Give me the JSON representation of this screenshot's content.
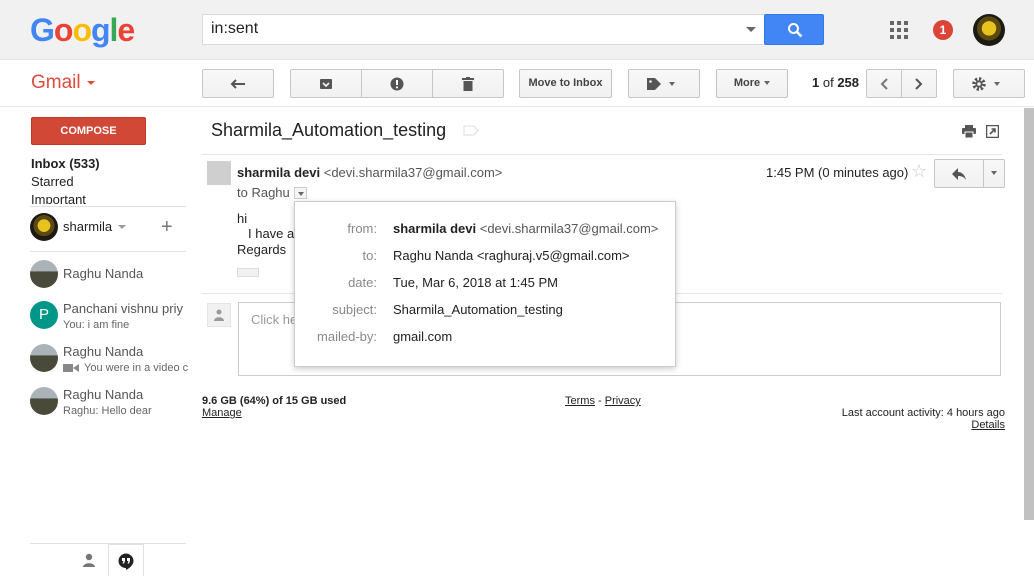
{
  "header": {
    "logo_letters": [
      {
        "ch": "G",
        "color": "#4285f4"
      },
      {
        "ch": "o",
        "color": "#ea4335"
      },
      {
        "ch": "o",
        "color": "#fbbc05"
      },
      {
        "ch": "g",
        "color": "#4285f4"
      },
      {
        "ch": "l",
        "color": "#34a853"
      },
      {
        "ch": "e",
        "color": "#ea4335"
      }
    ],
    "search_value": "in:sent",
    "notification_count": "1"
  },
  "toolbar": {
    "app_label": "Gmail",
    "move_to_inbox": "Move to Inbox",
    "more": "More",
    "pagination_current": "1",
    "pagination_of": "of",
    "pagination_total": "258"
  },
  "sidebar": {
    "compose": "COMPOSE",
    "nav": [
      {
        "label": "Inbox (533)",
        "bold": true
      },
      {
        "label": "Starred",
        "bold": false
      },
      {
        "label": "Important",
        "bold": false
      }
    ],
    "hangouts_user": "sharmila",
    "contacts": [
      {
        "name": "Raghu Nanda",
        "sub": "",
        "avatar": "mountain"
      },
      {
        "name": "Panchani vishnu priy",
        "sub": "You: i am fine",
        "avatar": "P"
      },
      {
        "name": "Raghu Nanda",
        "sub": "You were in a video c",
        "avatar": "mountain"
      },
      {
        "name": "Raghu Nanda",
        "sub": "Raghu: Hello dear",
        "avatar": "mountain"
      }
    ]
  },
  "email": {
    "subject": "Sharmila_Automation_testing",
    "sender_name": "sharmila devi",
    "sender_email": "<devi.sharmila37@gmail.com>",
    "to_line": "to Raghu",
    "time": "1:45 PM (0 minutes ago)",
    "body_line1": "hi",
    "body_line2": "I have a",
    "body_line3": "Regards",
    "reply_placeholder": "Click he"
  },
  "details_popup": {
    "rows": [
      {
        "label": "from:",
        "value_bold": "sharmila devi",
        "value": " <devi.sharmila37@gmail.com>"
      },
      {
        "label": "to:",
        "value_bold": "",
        "value": "Raghu Nanda <raghuraj.v5@gmail.com>"
      },
      {
        "label": "date:",
        "value_bold": "",
        "value": "Tue, Mar 6, 2018 at 1:45 PM"
      },
      {
        "label": "subject:",
        "value_bold": "",
        "value": "Sharmila_Automation_testing"
      },
      {
        "label": "mailed-by:",
        "value_bold": "",
        "value": "gmail.com"
      }
    ]
  },
  "footer": {
    "storage": "9.6 GB (64%) of 15 GB used",
    "manage": "Manage",
    "terms": "Terms",
    "separator": " - ",
    "privacy": "Privacy",
    "activity": "Last account activity: 4 hours ago",
    "details": "Details"
  },
  "colors": {
    "accent_red": "#dd4b39",
    "compose_bg": "#d14836",
    "search_blue": "#4285f4",
    "panchani_avatar": "#009688"
  }
}
